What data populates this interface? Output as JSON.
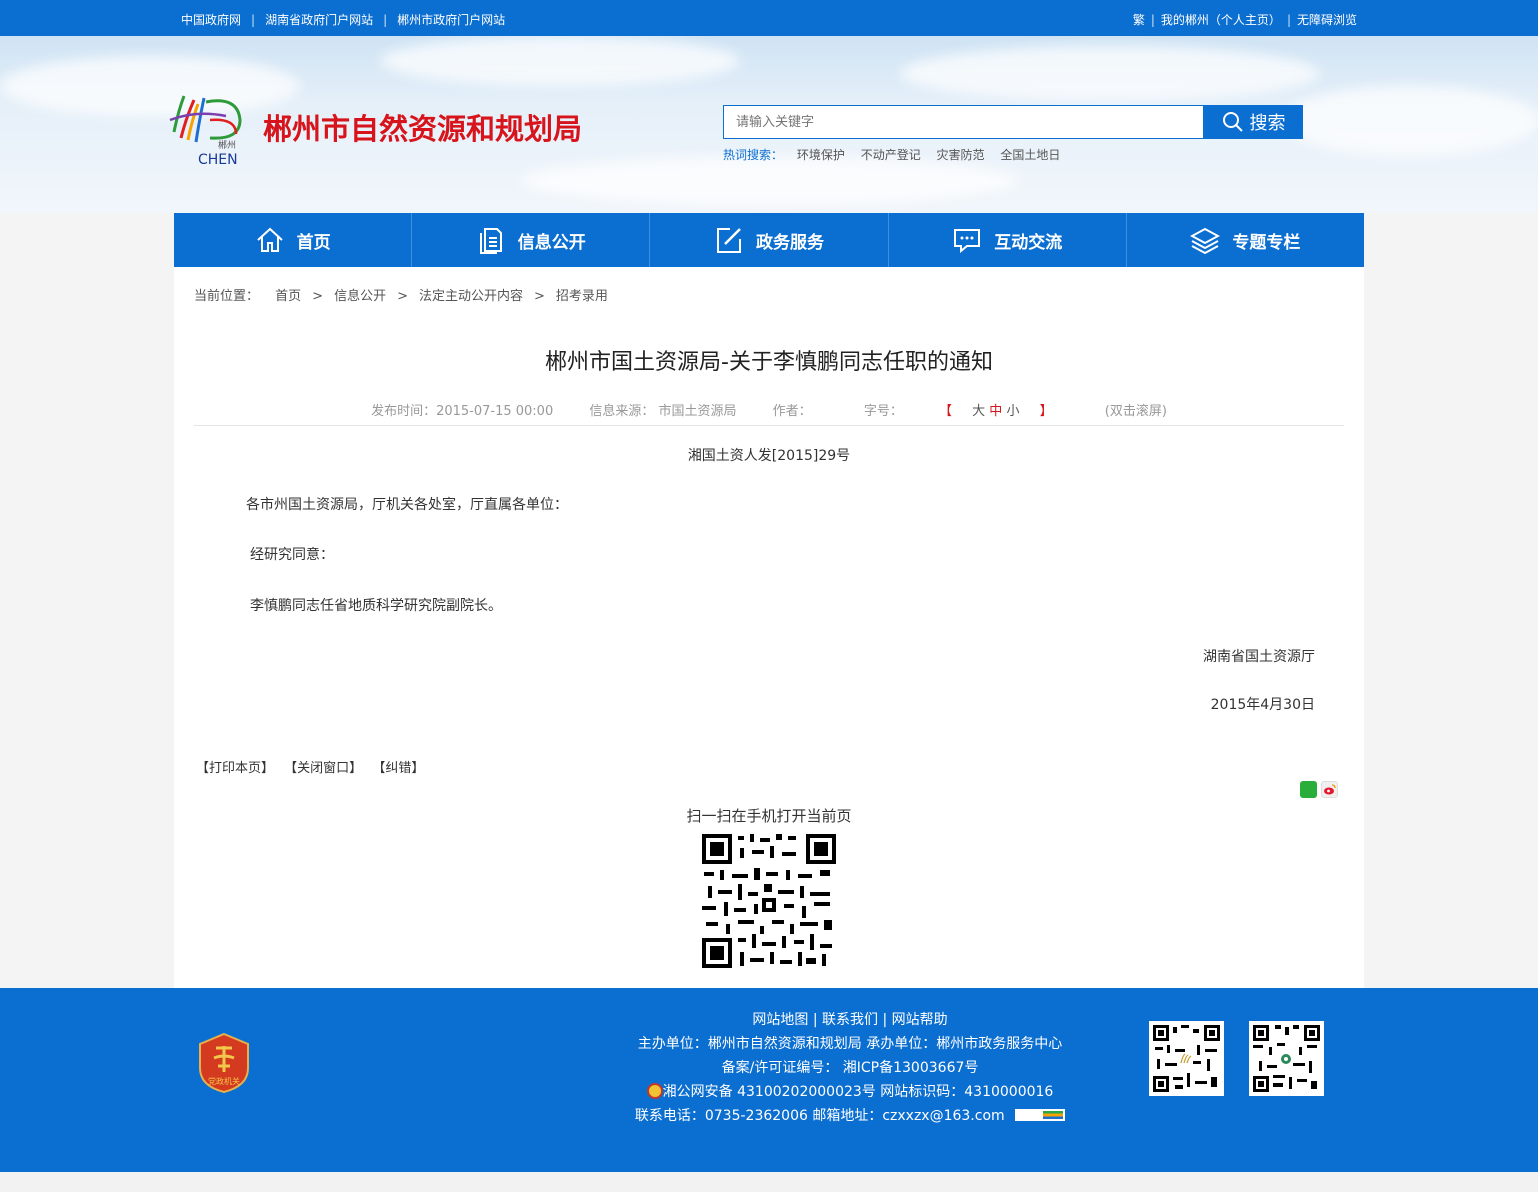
{
  "topbar": {
    "left_links": [
      "中国政府网",
      "湖南省政府门户网站",
      "郴州市政府门户网站"
    ],
    "right_links": [
      "繁",
      "我的郴州（个人主页）",
      "无障碍浏览"
    ]
  },
  "header": {
    "site_title": "郴州市自然资源和规划局",
    "logo_text_small": "郴州",
    "logo_text": "CHEN",
    "search_placeholder": "请输入关键字",
    "search_button": "搜索",
    "hot_label": "热词搜索：",
    "hot_words": [
      "环境保护",
      "不动产登记",
      "灾害防范",
      "全国土地日"
    ]
  },
  "nav": {
    "items": [
      "首页",
      "信息公开",
      "政务服务",
      "互动交流",
      "专题专栏"
    ]
  },
  "breadcrumb": {
    "label": "当前位置：",
    "items": [
      "首页",
      "信息公开",
      "法定主动公开内容",
      "招考录用"
    ]
  },
  "article": {
    "title": "郴州市国土资源局-关于李慎鹏同志任职的通知",
    "publish_time": "发布时间：2015-07-15 00:00",
    "source": "信息来源： 市国土资源局",
    "author": "作者：",
    "font_size_label": "字号：",
    "font_open": "【",
    "font_big": "大",
    "font_mid": "中",
    "font_small": "小",
    "font_close": "】",
    "dblclick": "(双击滚屏)",
    "doc_no": "湘国土资人发[2015]29号",
    "salutation": "各市州国土资源局，厅机关各处室，厅直属各单位：",
    "para1": "经研究同意：",
    "para2": "李慎鹏同志任省地质科学研究院副院长。",
    "signer": "湖南省国土资源厅",
    "date": "2015年4月30日"
  },
  "actions": {
    "print": "【打印本页】",
    "close": "【关闭窗口】",
    "correct": "【纠错】"
  },
  "scan_text": "扫一扫在手机打开当前页",
  "footer": {
    "links": [
      "网站地图",
      "联系我们",
      "网站帮助"
    ],
    "sponsor": "主办单位：郴州市自然资源和规划局    承办单位：郴州市政务服务中心",
    "icp": "备案/许可证编号： 湘ICP备13003667号",
    "police": "湘公网安备 43100202000023号    网站标识码：4310000016",
    "contact": "联系电话：0735-2362006    邮箱地址：czxxzx@163.com",
    "emblem_text": "党政机关"
  },
  "colors": {
    "primary": "#0b6ed1",
    "title_red": "#d7141b"
  }
}
